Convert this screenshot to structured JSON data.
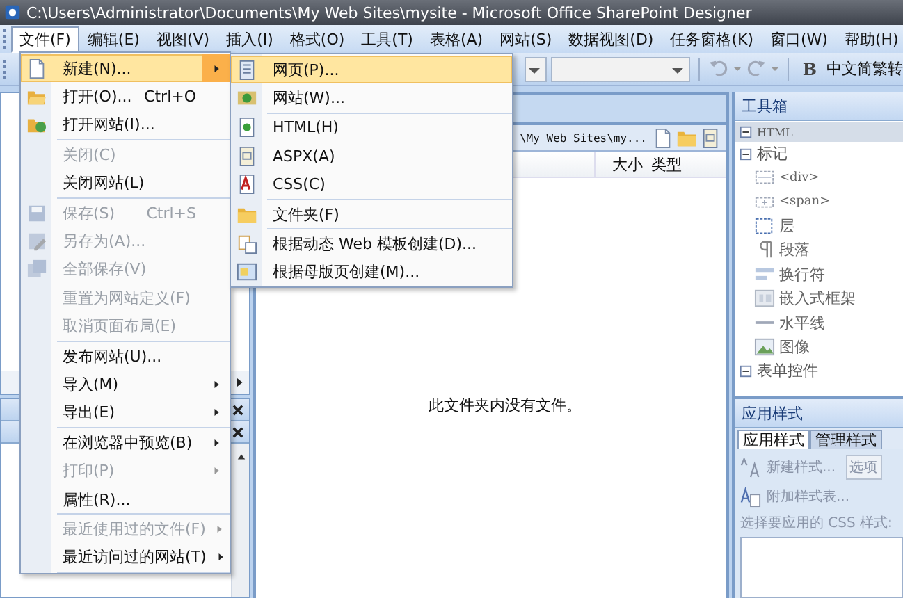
{
  "window": {
    "title": "C:\\Users\\Administrator\\Documents\\My Web Sites\\mysite - Microsoft Office SharePoint Designer"
  },
  "menu_bar": [
    {
      "label": "文件(F)",
      "selected": true
    },
    {
      "label": "编辑(E)",
      "selected": false
    },
    {
      "label": "视图(V)",
      "selected": false
    },
    {
      "label": "插入(I)",
      "selected": false
    },
    {
      "label": "格式(O)",
      "selected": false
    },
    {
      "label": "工具(T)",
      "selected": false
    },
    {
      "label": "表格(A)",
      "selected": false
    },
    {
      "label": "网站(S)",
      "selected": false
    },
    {
      "label": "数据视图(D)",
      "selected": false
    },
    {
      "label": "任务窗格(K)",
      "selected": false
    },
    {
      "label": "窗口(W)",
      "selected": false
    },
    {
      "label": "帮助(H)",
      "selected": false
    }
  ],
  "toolbar": {
    "bold": "B",
    "text": "中文简繁转"
  },
  "file_menu": {
    "groups": [
      [
        {
          "label": "新建(N)...",
          "submenu": true,
          "disabled": false,
          "selected": true
        },
        {
          "label": "打开(O)...",
          "shortcut": "Ctrl+O",
          "submenu": false,
          "disabled": false,
          "selected": false
        },
        {
          "label": "打开网站(I)...",
          "submenu": false,
          "disabled": false,
          "selected": false
        }
      ],
      [
        {
          "label": "关闭(C)",
          "submenu": false,
          "disabled": true,
          "selected": false
        },
        {
          "label": "关闭网站(L)",
          "submenu": false,
          "disabled": false,
          "selected": false
        }
      ],
      [
        {
          "label": "保存(S)",
          "shortcut": "Ctrl+S",
          "submenu": false,
          "disabled": true,
          "selected": false
        },
        {
          "label": "另存为(A)...",
          "submenu": false,
          "disabled": true,
          "selected": false
        },
        {
          "label": "全部保存(V)",
          "submenu": false,
          "disabled": true,
          "selected": false
        },
        {
          "label": "重置为网站定义(F)",
          "submenu": false,
          "disabled": true,
          "selected": false
        },
        {
          "label": "取消页面布局(E)",
          "submenu": false,
          "disabled": true,
          "selected": false
        }
      ],
      [
        {
          "label": "发布网站(U)...",
          "submenu": false,
          "disabled": false,
          "selected": false
        },
        {
          "label": "导入(M)",
          "submenu": true,
          "disabled": false,
          "selected": false
        },
        {
          "label": "导出(E)",
          "submenu": true,
          "disabled": false,
          "selected": false
        }
      ],
      [
        {
          "label": "在浏览器中预览(B)",
          "submenu": true,
          "disabled": false,
          "selected": false
        },
        {
          "label": "打印(P)",
          "submenu": true,
          "disabled": true,
          "selected": false
        },
        {
          "label": "属性(R)...",
          "submenu": false,
          "disabled": false,
          "selected": false
        }
      ],
      [
        {
          "label": "最近使用过的文件(F)",
          "submenu": true,
          "disabled": true,
          "selected": false
        },
        {
          "label": "最近访问过的网站(T)",
          "submenu": true,
          "disabled": false,
          "selected": false
        }
      ]
    ]
  },
  "new_submenu": {
    "groups": [
      [
        {
          "label": "网页(P)...",
          "selected": true
        },
        {
          "label": "网站(W)...",
          "selected": false
        }
      ],
      [
        {
          "label": "HTML(H)",
          "selected": false
        },
        {
          "label": "ASPX(A)",
          "selected": false
        },
        {
          "label": "CSS(C)",
          "selected": false
        }
      ],
      [
        {
          "label": "文件夹(F)",
          "selected": false
        }
      ],
      [
        {
          "label": "根据动态 Web 模板创建(D)...",
          "selected": false
        },
        {
          "label": "根据母版页创建(M)...",
          "selected": false
        }
      ]
    ]
  },
  "folder_view": {
    "path": "\\My Web Sites\\my...",
    "columns": [
      "大小",
      "类型"
    ],
    "empty_message": "此文件夹内没有文件。"
  },
  "toolbox": {
    "title": "工具箱",
    "items": [
      {
        "label": "HTML",
        "expanded": true,
        "children": [
          {
            "label": "标记",
            "expanded": true,
            "children": [
              {
                "label": "<div>"
              },
              {
                "label": "<span>"
              },
              {
                "label": "层"
              },
              {
                "label": "段落"
              },
              {
                "label": "换行符"
              },
              {
                "label": "嵌入式框架"
              },
              {
                "label": "水平线"
              },
              {
                "label": "图像"
              }
            ]
          },
          {
            "label": "表单控件",
            "expanded": true
          }
        ]
      }
    ]
  },
  "apply_styles": {
    "title": "应用样式",
    "tabs": [
      {
        "label": "应用样式",
        "selected": true
      },
      {
        "label": "管理样式",
        "selected": false
      }
    ],
    "actions": [
      "新建样式...",
      "附加样式表..."
    ],
    "options_button": "选项",
    "prompt": "选择要应用的 CSS 样式:"
  }
}
